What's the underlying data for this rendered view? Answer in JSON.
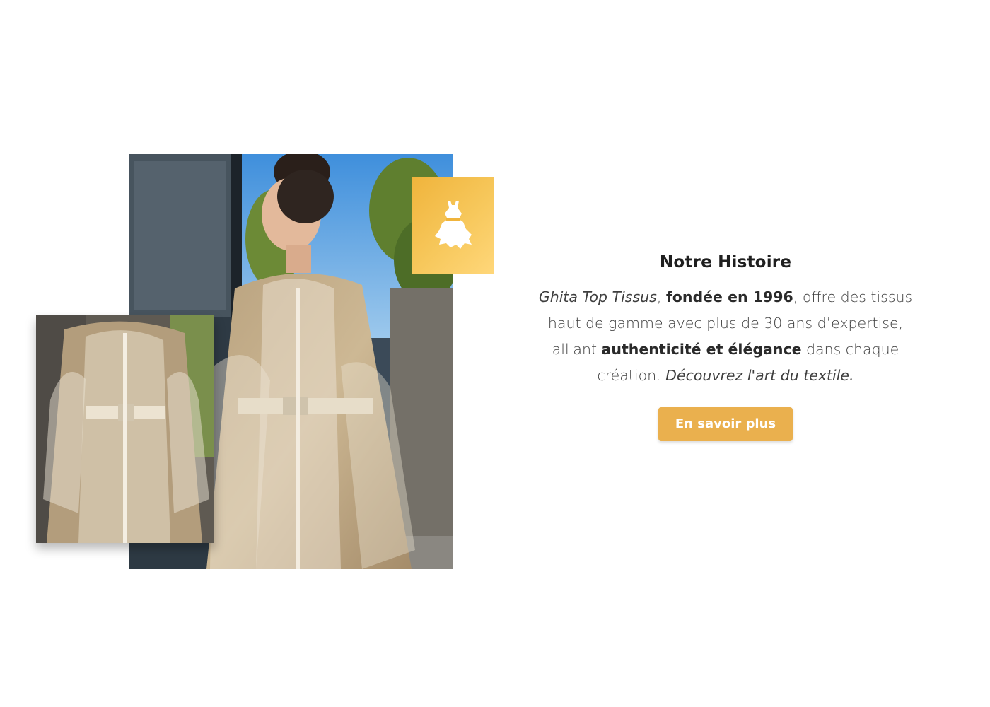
{
  "story": {
    "title": "Notre Histoire",
    "paragraph": {
      "brand": "Ghita Top Tissus",
      "comma1": ", ",
      "founded": "fondée en 1996",
      "part2": ", offre des tissus haut de gamme avec plus de 30 ans d’expertise, alliant ",
      "values": "authenticité et élégance",
      "part3": " dans chaque création. ",
      "tagline": "Découvrez l'art du textile."
    },
    "cta_label": "En savoir plus"
  },
  "icons": {
    "badge": "dress-icon"
  },
  "colors": {
    "accent": "#eab04e",
    "badge_gold": "#f0b43c",
    "title": "#1f1f1f",
    "body_text": "#3f3f3f"
  }
}
